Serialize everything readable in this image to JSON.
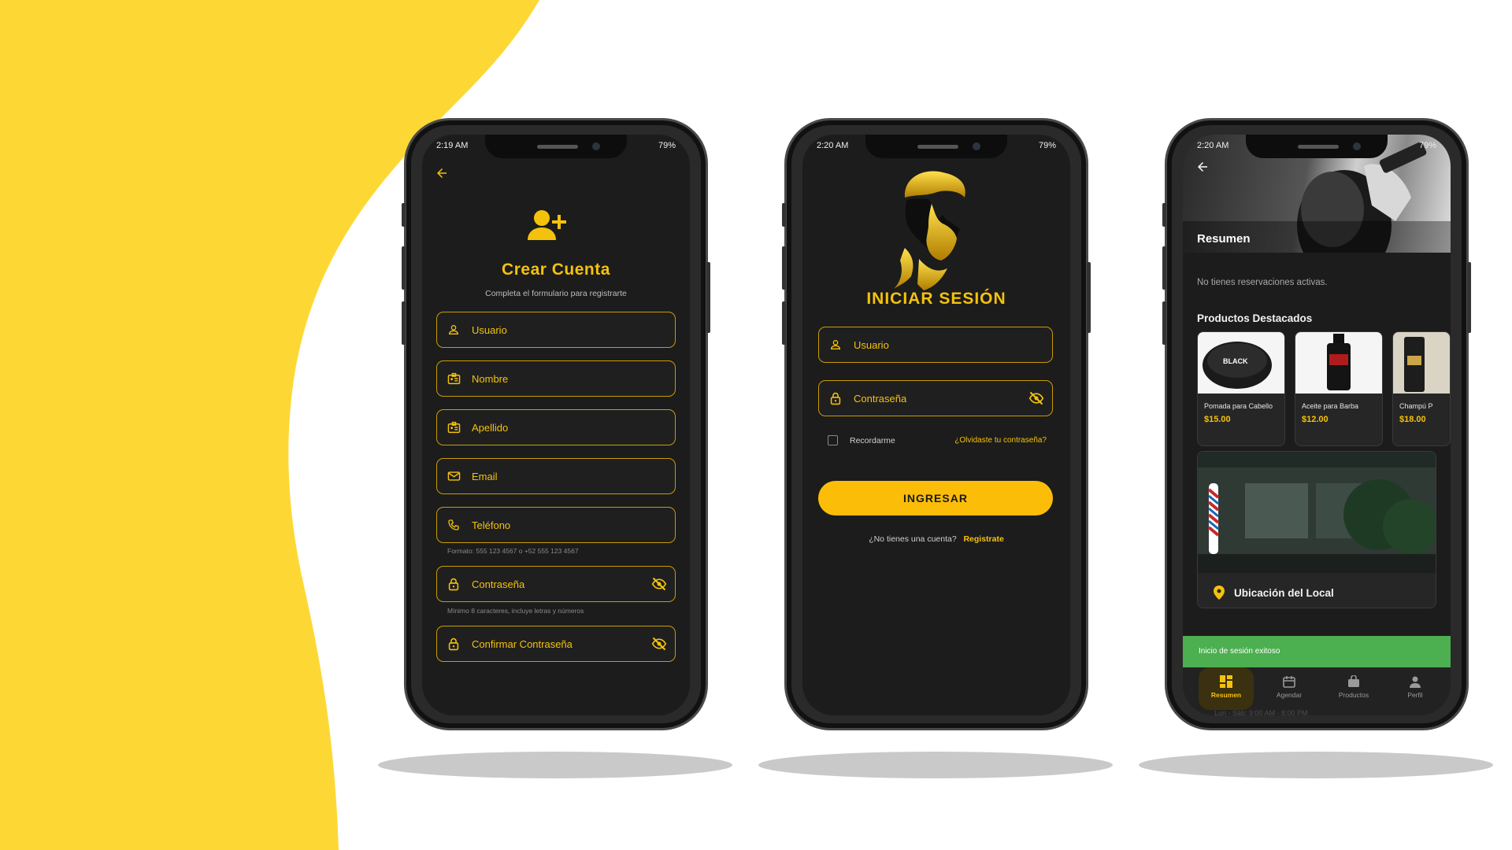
{
  "colors": {
    "accent": "#f4c20d",
    "screen_bg": "#1c1c1c",
    "toast_bg": "#4caf50",
    "background_blob": "#fdd835"
  },
  "phone1": {
    "status_time": "2:19 AM",
    "status_battery": "79",
    "title": "Crear Cuenta",
    "subtitle": "Completa el formulario para registrarte",
    "fields": {
      "usuario": "Usuario",
      "nombre": "Nombre",
      "apellido": "Apellido",
      "email": "Email",
      "telefono": "Teléfono",
      "contrasena": "Contraseña",
      "confirmar": "Confirmar Contraseña"
    },
    "phone_hint": "Formato: 555 123 4567 o +52 555 123 4567",
    "password_hint": "Mínimo 8 caracteres, incluye letras y números",
    "icons": {
      "back": "arrow-left-icon",
      "header": "person-add-icon",
      "user": "person-icon",
      "id": "badge-icon",
      "mail": "mail-icon",
      "phone": "phone-icon",
      "lock": "lock-icon",
      "eye": "eye-off-icon"
    }
  },
  "phone2": {
    "status_time": "2:20 AM",
    "status_battery": "79",
    "title": "INICIAR SESIÓN",
    "usuario": "Usuario",
    "contrasena": "Contraseña",
    "remember": "Recordarme",
    "forgot": "¿Olvidaste tu contraseña?",
    "submit": "INGRESAR",
    "no_account": "¿No tienes una cuenta?",
    "register": "Registrate",
    "icons": {
      "logo": "barber-logo",
      "user": "person-icon",
      "lock": "lock-icon",
      "eye": "eye-off-icon",
      "checkbox": "checkbox-icon"
    }
  },
  "phone3": {
    "status_time": "2:20 AM",
    "status_battery": "79",
    "header_title": "Resumen",
    "no_reservations": "No tienes reservaciones activas.",
    "products_title": "Productos Destacados",
    "products": [
      {
        "name": "Pomada para Cabello",
        "price": "$15.00"
      },
      {
        "name": "Aceite para Barba",
        "price": "$12.00"
      },
      {
        "name": "Champú P",
        "price": "$18.00"
      }
    ],
    "location_title": "Ubicación del Local",
    "toast": "Inicio de sesión exitoso",
    "hours_partial": "Lun - Sáb: 9:00 AM - 8:00 PM",
    "nav": [
      {
        "label": "Resumen",
        "icon": "dashboard-icon"
      },
      {
        "label": "Agendar",
        "icon": "calendar-icon"
      },
      {
        "label": "Productos",
        "icon": "bag-icon"
      },
      {
        "label": "Perfil",
        "icon": "person-icon"
      }
    ]
  }
}
